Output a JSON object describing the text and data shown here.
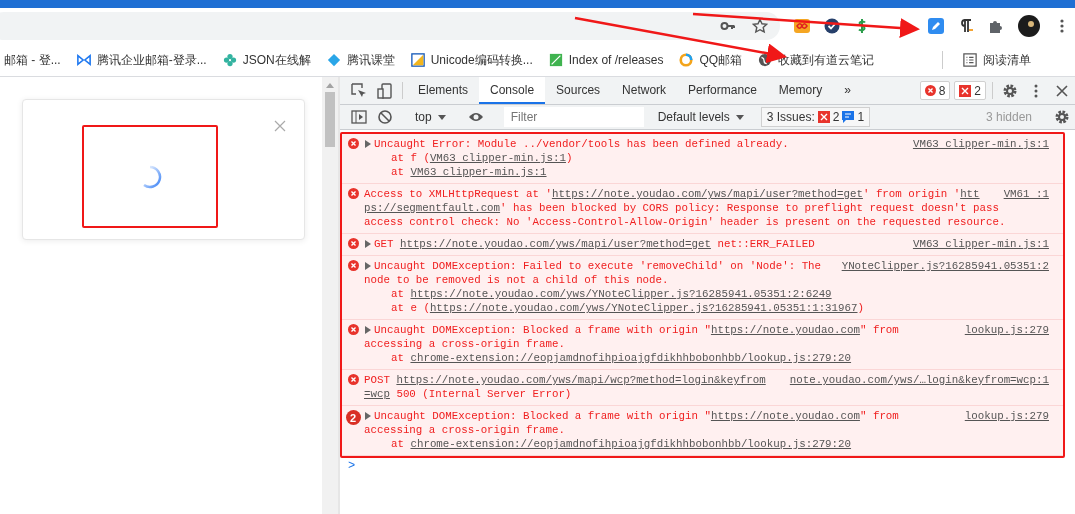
{
  "bookmarks": [
    {
      "label": "邮箱 - 登..."
    },
    {
      "label": "腾讯企业邮箱-登录..."
    },
    {
      "label": "JSON在线解"
    },
    {
      "label": "腾讯课堂"
    },
    {
      "label": "Unicode编码转换..."
    },
    {
      "label": "Index of /releases"
    },
    {
      "label": "QQ邮箱"
    },
    {
      "label": "收藏到有道云笔记"
    }
  ],
  "reading_list": "阅读清单",
  "devtools": {
    "tabs": [
      {
        "label": "Elements",
        "selected": false
      },
      {
        "label": "Console",
        "selected": true
      },
      {
        "label": "Sources",
        "selected": false
      },
      {
        "label": "Network",
        "selected": false
      },
      {
        "label": "Performance",
        "selected": false
      },
      {
        "label": "Memory",
        "selected": false
      }
    ],
    "more": "»",
    "error_count": "8",
    "issue_count": "2",
    "console_toolbar": {
      "context": "top",
      "filter_placeholder": "Filter",
      "levels": "Default levels",
      "issues_label": "3 Issues:",
      "issues_errors": "2",
      "issues_info": "1",
      "hidden": "3 hidden"
    },
    "messages": [
      {
        "expandable": true,
        "source": "VM63 clipper-min.js:1",
        "lines": [
          {
            "indent": false,
            "parts": [
              {
                "text": "Uncaught Error: Module ../vendor/tools has been defined already.",
                "link": false
              }
            ]
          },
          {
            "indent": true,
            "parts": [
              {
                "text": "at f (",
                "link": false
              },
              {
                "text": "VM63 clipper-min.js:1",
                "link": true
              },
              {
                "text": ")",
                "link": false
              }
            ]
          },
          {
            "indent": true,
            "parts": [
              {
                "text": "at ",
                "link": false
              },
              {
                "text": "VM63 clipper-min.js:1",
                "link": true
              }
            ]
          }
        ]
      },
      {
        "expandable": false,
        "source": "VM61 :1",
        "lines": [
          {
            "indent": false,
            "parts": [
              {
                "text": "Access to XMLHttpRequest at '",
                "link": false
              },
              {
                "text": "https://note.youdao.com/yws/mapi/user?method=get",
                "link": true
              },
              {
                "text": "' from origin '",
                "link": false
              },
              {
                "text": "htt",
                "link": true
              }
            ]
          },
          {
            "indent": false,
            "parts": [
              {
                "text": "ps://segmentfault.com",
                "link": true
              },
              {
                "text": "' has been blocked by CORS policy: Response to preflight request doesn't pass",
                "link": false
              }
            ]
          },
          {
            "indent": false,
            "parts": [
              {
                "text": "access control check: No 'Access-Control-Allow-Origin' header is present on the requested resource.",
                "link": false
              }
            ]
          }
        ]
      },
      {
        "expandable": true,
        "source": "VM63 clipper-min.js:1",
        "lines": [
          {
            "indent": false,
            "parts": [
              {
                "text": "GET ",
                "link": false
              },
              {
                "text": "https://note.youdao.com/yws/mapi/user?method=get",
                "link": true
              },
              {
                "text": " net::ERR_FAILED",
                "link": false
              }
            ]
          }
        ]
      },
      {
        "expandable": true,
        "source": "YNoteClipper.js?16285941.05351:2",
        "lines": [
          {
            "indent": false,
            "parts": [
              {
                "text": "Uncaught DOMException: Failed to execute 'removeChild' on 'Node': The",
                "link": false
              }
            ]
          },
          {
            "indent": false,
            "parts": [
              {
                "text": "node to be removed is not a child of this node.",
                "link": false
              }
            ]
          },
          {
            "indent": true,
            "parts": [
              {
                "text": "at ",
                "link": false
              },
              {
                "text": "https://note.youdao.com/yws/YNoteClipper.js?16285941.05351:2:6249",
                "link": true
              }
            ]
          },
          {
            "indent": true,
            "parts": [
              {
                "text": "at e (",
                "link": false
              },
              {
                "text": "https://note.youdao.com/yws/YNoteClipper.js?16285941.05351:1:31967",
                "link": true
              },
              {
                "text": ")",
                "link": false
              }
            ]
          }
        ]
      },
      {
        "expandable": true,
        "source": "lookup.js:279",
        "lines": [
          {
            "indent": false,
            "parts": [
              {
                "text": "Uncaught DOMException: Blocked a frame with origin \"",
                "link": false
              },
              {
                "text": "https://note.youdao.com",
                "link": true
              },
              {
                "text": "\" from",
                "link": false
              }
            ]
          },
          {
            "indent": false,
            "parts": [
              {
                "text": "accessing a cross-origin frame.",
                "link": false
              }
            ]
          },
          {
            "indent": true,
            "parts": [
              {
                "text": "at ",
                "link": false
              },
              {
                "text": "chrome-extension://eopjamdnofihpioajgfdikhhbobonhbb/lookup.js:279:20",
                "link": true
              }
            ]
          }
        ]
      },
      {
        "expandable": false,
        "source": "note.youdao.com/yws/…login&keyfrom=wcp:1",
        "lines": [
          {
            "indent": false,
            "parts": [
              {
                "text": "POST ",
                "link": false
              },
              {
                "text": "https://note.youdao.com/yws/mapi/wcp?method=login&keyfrom",
                "link": true
              }
            ]
          },
          {
            "indent": false,
            "parts": [
              {
                "text": "=wcp",
                "link": true
              },
              {
                "text": " 500 (Internal Server Error)",
                "link": false
              }
            ]
          }
        ]
      },
      {
        "expandable": true,
        "count": "2",
        "source": "lookup.js:279",
        "lines": [
          {
            "indent": false,
            "parts": [
              {
                "text": "Uncaught DOMException: Blocked a frame with origin \"",
                "link": false
              },
              {
                "text": "https://note.youdao.com",
                "link": true
              },
              {
                "text": "\" from",
                "link": false
              }
            ]
          },
          {
            "indent": false,
            "parts": [
              {
                "text": "accessing a cross-origin frame.",
                "link": false
              }
            ]
          },
          {
            "indent": true,
            "parts": [
              {
                "text": "at ",
                "link": false
              },
              {
                "text": "chrome-extension://eopjamdnofihpioajgfdikhhbobonhbb/lookup.js:279:20",
                "link": true
              }
            ]
          }
        ]
      }
    ],
    "prompt": ">"
  }
}
